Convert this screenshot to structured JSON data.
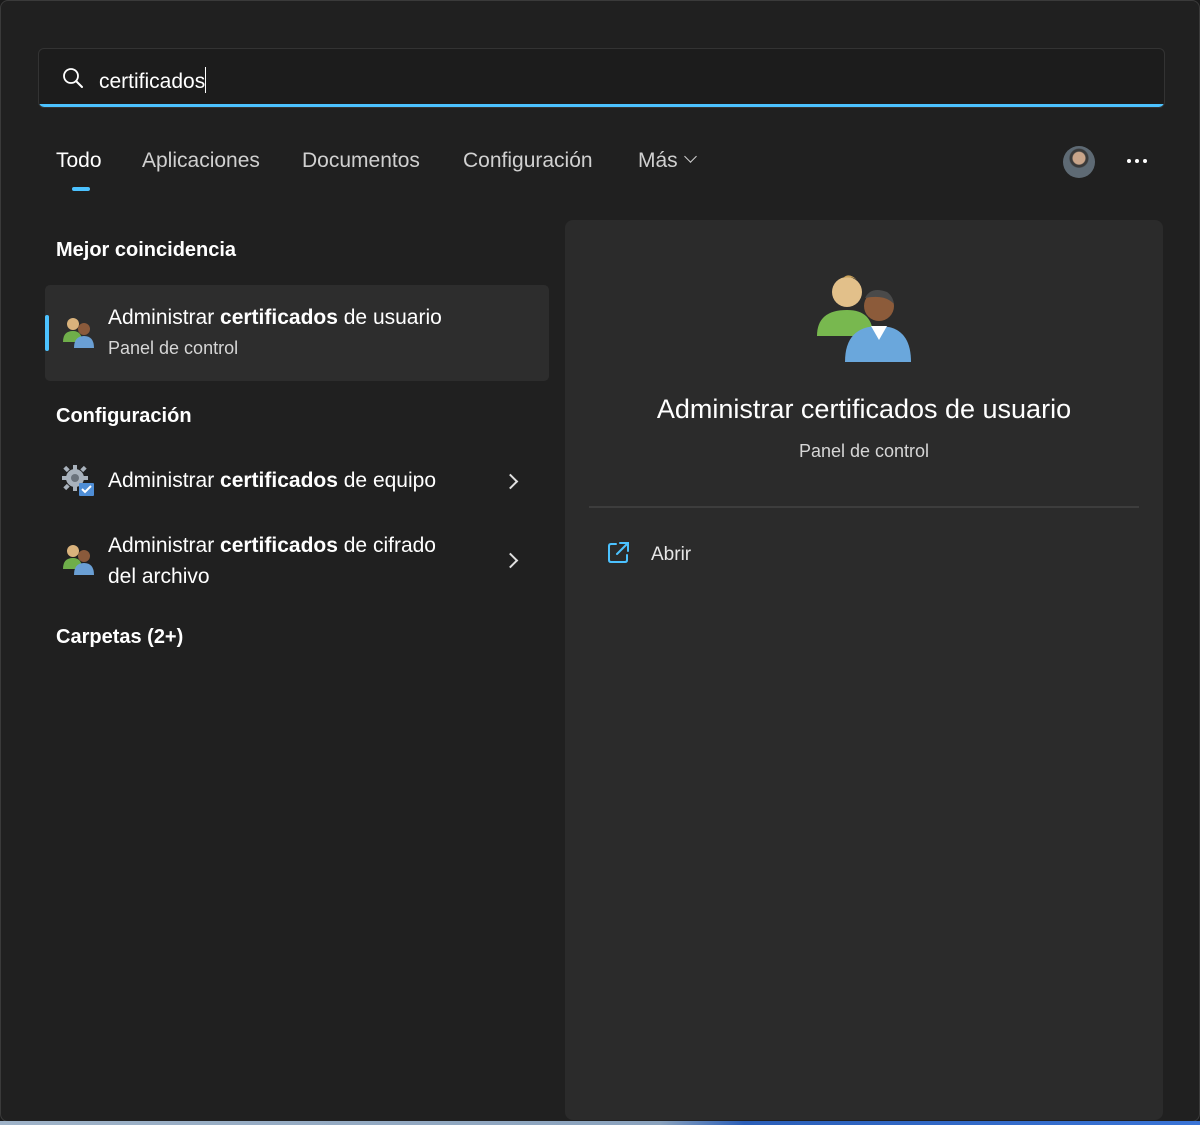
{
  "search": {
    "value": "certificados",
    "accent": "#4cc2ff"
  },
  "tabs": [
    {
      "label": "Todo",
      "active": true
    },
    {
      "label": "Aplicaciones"
    },
    {
      "label": "Documentos"
    },
    {
      "label": "Configuración"
    },
    {
      "label": "Más"
    }
  ],
  "toolbar": {
    "avatar_icon": "user-avatar",
    "more_icon": "more-options-icon"
  },
  "best_match": {
    "header": "Mejor coincidencia",
    "item": {
      "title_prefix": "Administrar ",
      "title_bold": "certificados",
      "title_suffix": " de usuario",
      "subtitle": "Panel de control",
      "icon": "users-icon"
    }
  },
  "settings": {
    "header": "Configuración",
    "items": [
      {
        "title_prefix": "Administrar ",
        "title_bold": "certificados",
        "title_suffix": " de equipo",
        "icon": "gear-certificate-icon"
      },
      {
        "title_prefix": "Administrar ",
        "title_bold": "certificados",
        "title_suffix": " de cifrado",
        "title_line2": "del archivo",
        "icon": "users-icon"
      }
    ]
  },
  "folders": {
    "header": "Carpetas (2+)"
  },
  "preview": {
    "title": "Administrar certificados de usuario",
    "subtitle": "Panel de control",
    "icon": "users-icon",
    "actions": [
      {
        "label": "Abrir",
        "icon": "open-external-icon"
      }
    ]
  }
}
